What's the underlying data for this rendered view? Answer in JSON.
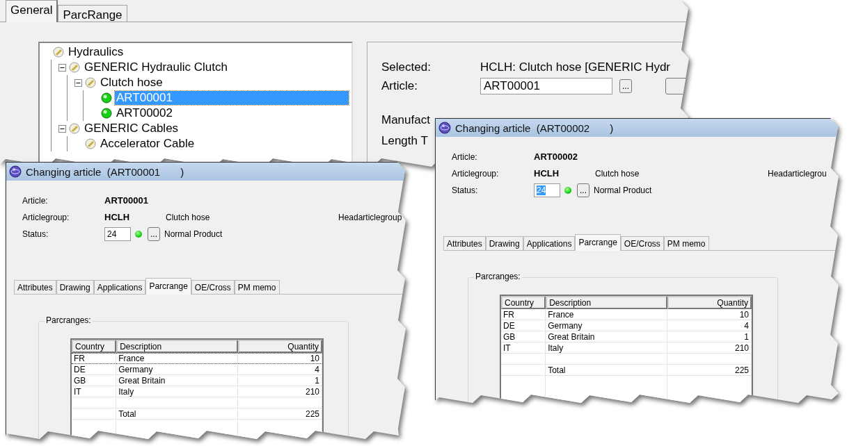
{
  "back": {
    "tabs": [
      {
        "label": "General",
        "selected": true
      },
      {
        "label": "ParcRange",
        "selected": false
      }
    ],
    "tree": [
      {
        "label": "Hydraulics",
        "kind": "group",
        "selected": false,
        "children": [
          {
            "label": "GENERIC Hydraulic Clutch",
            "kind": "group",
            "selected": false,
            "expanded": true,
            "children": [
              {
                "label": "Clutch hose",
                "kind": "group",
                "selected": false,
                "expanded": true,
                "children": [
                  {
                    "label": "ART00001",
                    "kind": "article",
                    "selected": true
                  },
                  {
                    "label": "ART00002",
                    "kind": "article",
                    "selected": false
                  }
                ]
              }
            ]
          },
          {
            "label": "GENERIC Cables",
            "kind": "group",
            "selected": false,
            "expanded": true,
            "children": [
              {
                "label": "Accelerator Cable",
                "kind": "group",
                "selected": false
              }
            ]
          }
        ]
      }
    ],
    "details": [
      {
        "label": "Selected:",
        "kind": "text",
        "value": "HCLH: Clutch hose [GENERIC Hydr"
      },
      {
        "label": "Article:",
        "kind": "field",
        "value": "ART00001",
        "button": "..."
      },
      {
        "label": "Manufact",
        "kind": "label"
      },
      {
        "label": "Length T",
        "kind": "label"
      }
    ]
  },
  "windows": [
    {
      "title": "Changing article  (ART00001       )",
      "article_label": "Article:",
      "article": "ART00001",
      "group_label": "Articlegroup:",
      "group_code": "HCLH",
      "group_name": "Clutch hose",
      "head_label": "Headarticlegroup",
      "status_label": "Status:",
      "status": {
        "value": "24",
        "selected": false
      },
      "status_button": "...",
      "status_text": "Normal Product",
      "tabs": [
        {
          "label": "Attributes",
          "selected": false
        },
        {
          "label": "Drawing",
          "selected": false
        },
        {
          "label": "Applications",
          "selected": false
        },
        {
          "label": "Parcrange",
          "selected": true
        },
        {
          "label": "OE/Cross",
          "selected": false
        },
        {
          "label": "PM memo",
          "selected": false
        }
      ],
      "group_title": "Parcranges:",
      "columns": [
        "Country",
        "Description",
        "Quantity"
      ],
      "rows": [
        {
          "country": "FR",
          "description": "France",
          "quantity": "10",
          "selected": true
        },
        {
          "country": "DE",
          "description": "Germany",
          "quantity": "4",
          "selected": false
        },
        {
          "country": "GB",
          "description": "Great Britain",
          "quantity": "1",
          "selected": false
        },
        {
          "country": "IT",
          "description": "Italy",
          "quantity": "210",
          "selected": false
        },
        {
          "selected": false
        },
        {
          "description": "Total",
          "quantity": "225",
          "selected": false
        }
      ]
    },
    {
      "title": "Changing article  (ART00002       )",
      "article_label": "Article:",
      "article": "ART00002",
      "group_label": "Articlegroup:",
      "group_code": "HCLH",
      "group_name": "Clutch hose",
      "head_label": "Headarticlegrou",
      "status_label": "Status:",
      "status": {
        "value": "24",
        "selected": true
      },
      "status_button": "...",
      "status_text": "Normal Product",
      "tabs": [
        {
          "label": "Attributes",
          "selected": false
        },
        {
          "label": "Drawing",
          "selected": false
        },
        {
          "label": "Applications",
          "selected": false
        },
        {
          "label": "Parcrange",
          "selected": true
        },
        {
          "label": "OE/Cross",
          "selected": false
        },
        {
          "label": "PM memo",
          "selected": false
        }
      ],
      "group_title": "Parcranges:",
      "columns": [
        "Country",
        "Description",
        "Quantity"
      ],
      "rows": [
        {
          "country": "FR",
          "description": "France",
          "quantity": "10",
          "selected": false
        },
        {
          "country": "DE",
          "description": "Germany",
          "quantity": "4",
          "selected": false
        },
        {
          "country": "GB",
          "description": "Great Britain",
          "quantity": "1",
          "selected": false
        },
        {
          "country": "IT",
          "description": "Italy",
          "quantity": "210",
          "selected": false
        },
        {
          "selected": false
        },
        {
          "description": "Total",
          "quantity": "225",
          "selected": false
        }
      ]
    }
  ]
}
